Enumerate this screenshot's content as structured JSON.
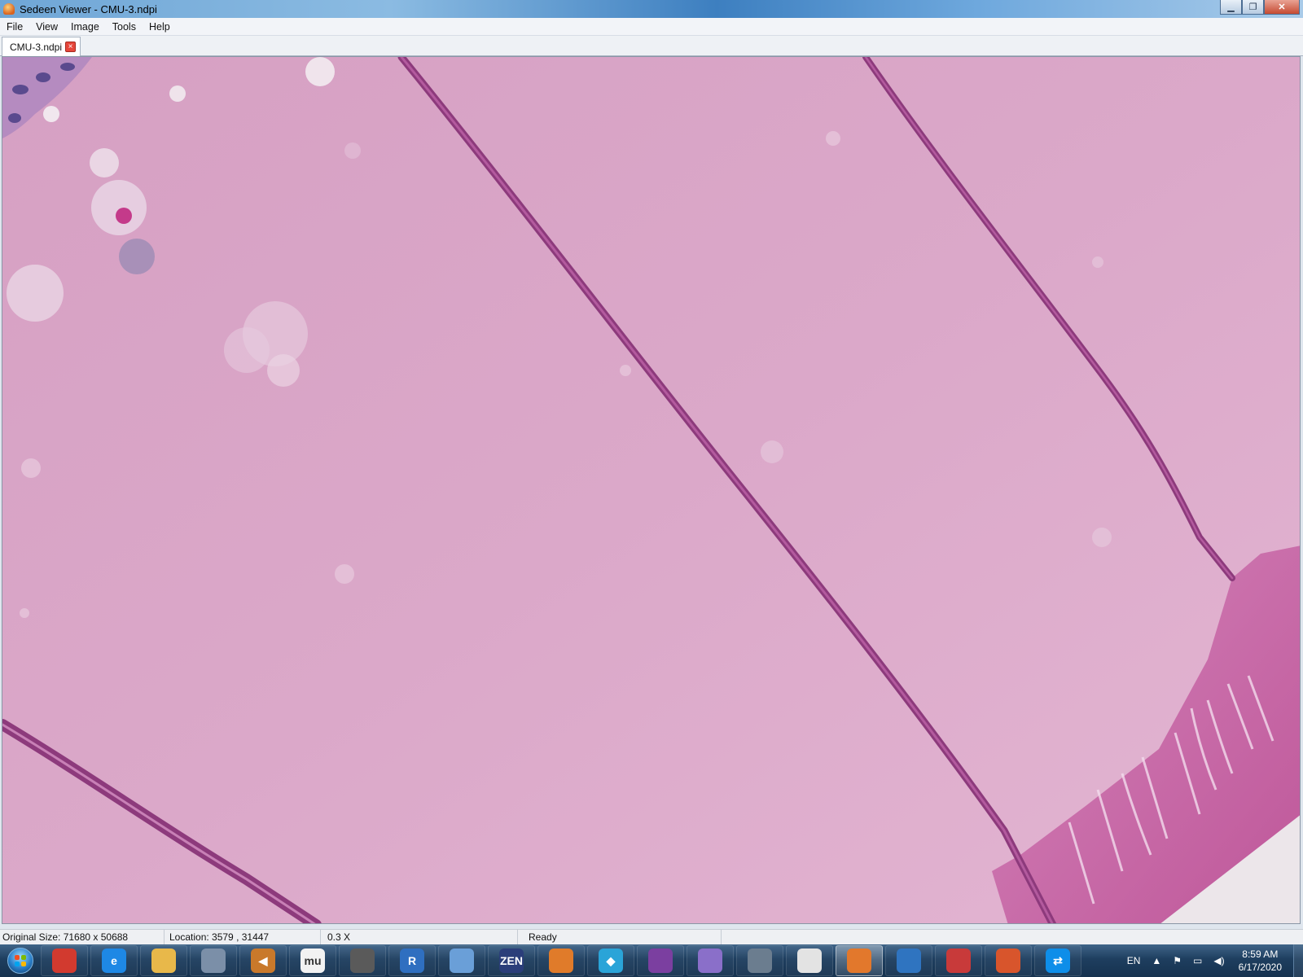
{
  "window": {
    "title": "Sedeen Viewer - CMU-3.ndpi",
    "minimize": "▁",
    "restore": "❐",
    "close": "✕"
  },
  "menu": {
    "items": [
      "File",
      "View",
      "Image",
      "Tools",
      "Help"
    ]
  },
  "tabs": [
    {
      "label": "CMU-3.ndpi",
      "close": "×"
    }
  ],
  "status": {
    "original_size": "Original Size: 71680 x 50688",
    "location": "Location: 3579 , 31447",
    "zoom": "0.3 X",
    "state": "Ready"
  },
  "taskbar": {
    "apps": [
      {
        "name": "chrome-icon",
        "glyph": "",
        "color": "#d23a2f"
      },
      {
        "name": "internet-explorer-icon",
        "glyph": "e",
        "color": "#1e88e5"
      },
      {
        "name": "file-explorer-icon",
        "glyph": "",
        "color": "#e8b84a"
      },
      {
        "name": "calculator-icon",
        "glyph": "",
        "color": "#7b8fa8"
      },
      {
        "name": "speaker-icon",
        "glyph": "◀",
        "color": "#c9792b"
      },
      {
        "name": "mu-editor-icon",
        "glyph": "mu",
        "color": "#f2f2f2"
      },
      {
        "name": "microphone-icon",
        "glyph": "",
        "color": "#5a5a5a"
      },
      {
        "name": "r-icon",
        "glyph": "R",
        "color": "#2f6fc0"
      },
      {
        "name": "paint-icon",
        "glyph": "",
        "color": "#6a9fd8"
      },
      {
        "name": "zen-icon",
        "glyph": "ZEN",
        "color": "#2b3e7a"
      },
      {
        "name": "cubes-icon",
        "glyph": "",
        "color": "#e07b2a"
      },
      {
        "name": "diamond-icon",
        "glyph": "◆",
        "color": "#2aa4d8"
      },
      {
        "name": "cat-icon",
        "glyph": "",
        "color": "#7b3fa0"
      },
      {
        "name": "magnifier-icon",
        "glyph": "",
        "color": "#8a6fc9"
      },
      {
        "name": "search-globe-icon",
        "glyph": "",
        "color": "#6b7d8f"
      },
      {
        "name": "slide-icon",
        "glyph": "",
        "color": "#e3e3e3"
      },
      {
        "name": "sedeen-icon",
        "glyph": "",
        "color": "#e2782c",
        "active": true
      },
      {
        "name": "remote-desktop-icon",
        "glyph": "",
        "color": "#2f74c0"
      },
      {
        "name": "snipping-icon",
        "glyph": "",
        "color": "#c83a3a"
      },
      {
        "name": "matlab-icon",
        "glyph": "",
        "color": "#d8552c"
      },
      {
        "name": "teamviewer-icon",
        "glyph": "⇄",
        "color": "#0e8ee9"
      }
    ],
    "tray": {
      "language": "EN",
      "time": "8:59 AM",
      "date": "6/17/2020"
    }
  },
  "colors": {
    "tissue_background": "#d9a6c7",
    "fiber": "#8d3a7c",
    "stroma": "#c25aa0"
  }
}
